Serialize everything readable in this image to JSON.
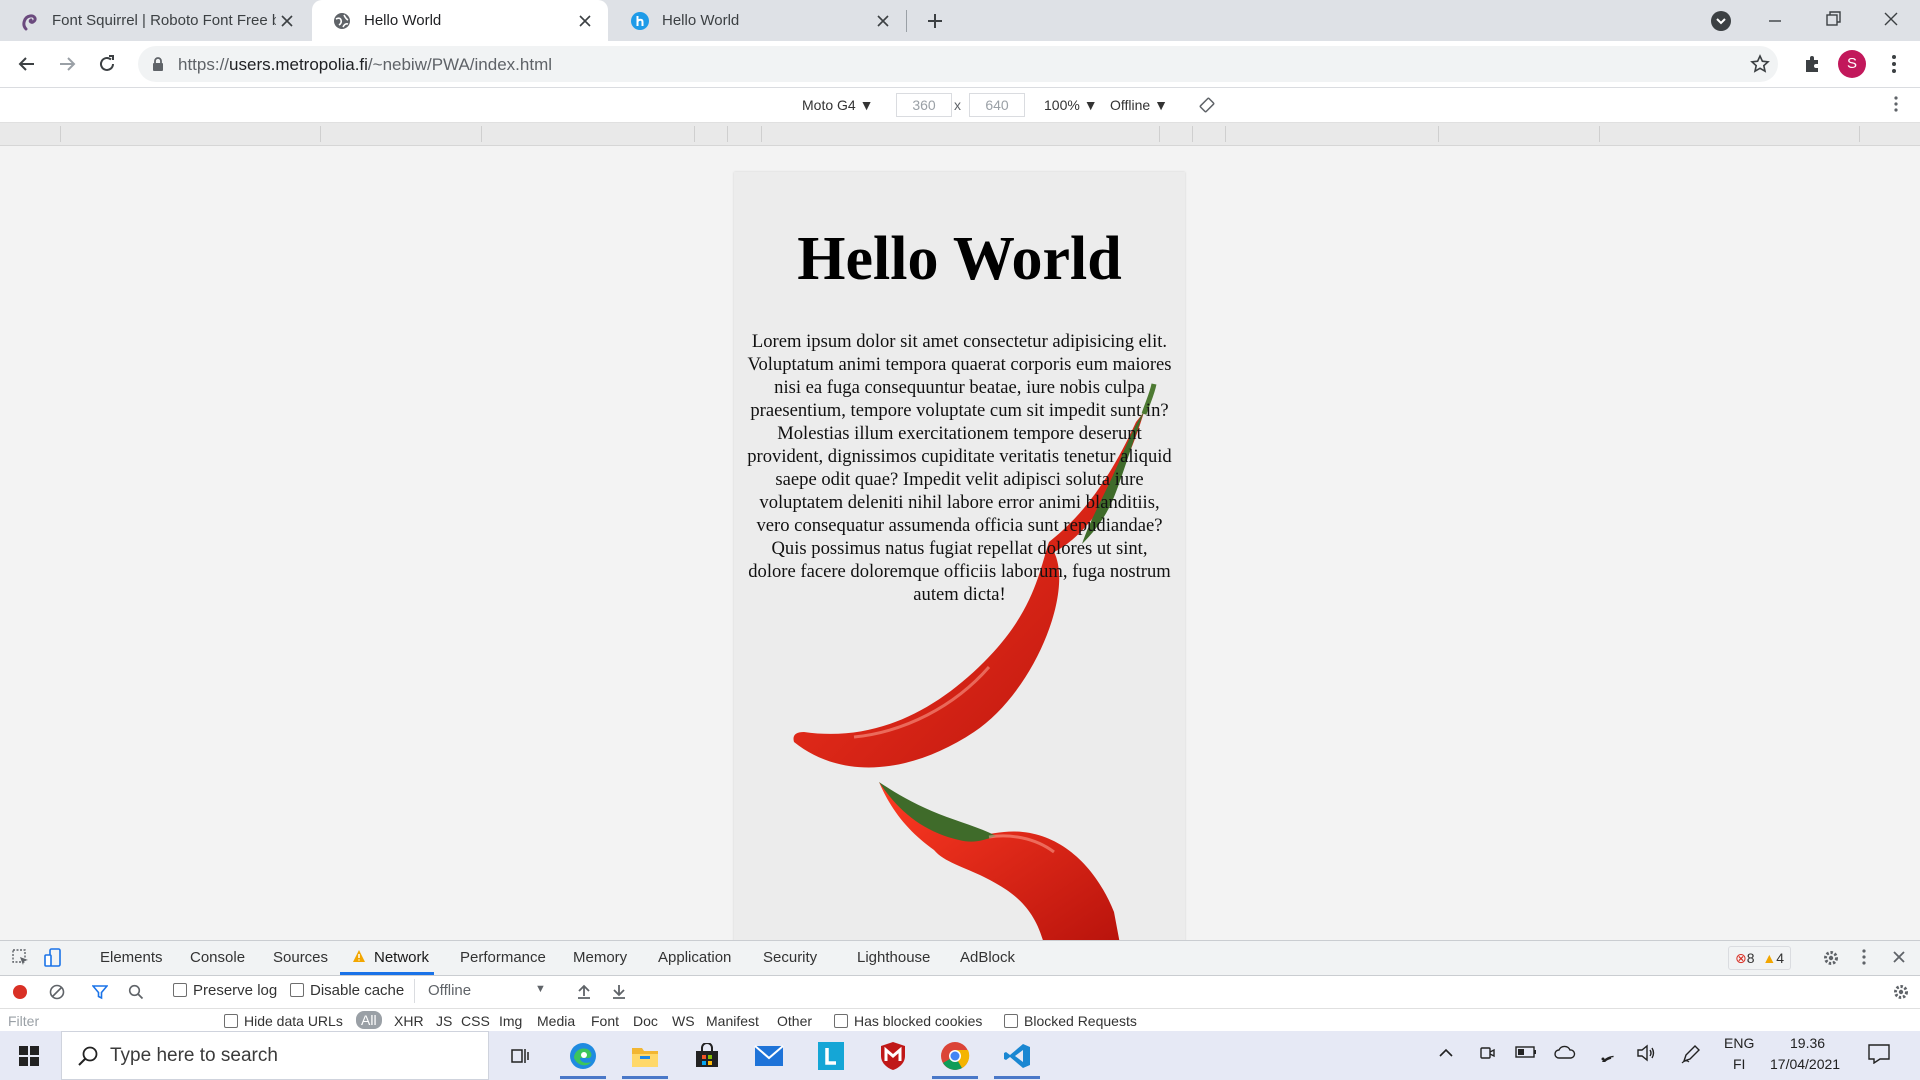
{
  "tabs": [
    {
      "title": "Font Squirrel | Roboto Font Free b",
      "icon": "squirrel-icon"
    },
    {
      "title": "Hello World",
      "icon": "globe-icon",
      "active": true
    },
    {
      "title": "Hello World",
      "icon": "h-app-icon"
    }
  ],
  "address": {
    "host": "users.metropolia.fi",
    "path": "/~nebiw/PWA/index.html"
  },
  "profile_initial": "S",
  "device_toolbar": {
    "device": "Moto G4 ▼",
    "width": "360",
    "times": "x",
    "height": "640",
    "zoom": "100% ▼",
    "throttle": "Offline ▼"
  },
  "page": {
    "heading": "Hello World",
    "body": "Lorem ipsum dolor sit amet consectetur adipisicing elit. Voluptatum animi tempora quaerat corporis eum maiores nisi ea fuga consequuntur beatae, iure nobis culpa praesentium, tempore voluptate cum sit impedit sunt in? Molestias illum exercitationem tempore deserunt provident, dignissimos cupiditate veritatis tenetur aliquid saepe odit quae? Impedit velit adipisci soluta iure voluptatem deleniti nihil labore error animi blanditiis, vero consequatur assumenda officia sunt repudiandae? Quis possimus natus fugiat repellat dolores ut sint, dolore facere doloremque officiis laborum, fuga nostrum autem dicta!"
  },
  "devtools": {
    "tabs": [
      "Elements",
      "Console",
      "Sources",
      "Network",
      "Performance",
      "Memory",
      "Application",
      "Security",
      "Lighthouse",
      "AdBlock"
    ],
    "errors": "8",
    "warnings": "4",
    "preserve_log": "Preserve log",
    "disable_cache": "Disable cache",
    "throttling": "Offline",
    "filter_placeholder": "Filter",
    "hide_data_urls": "Hide data URLs",
    "types": [
      "All",
      "XHR",
      "JS",
      "CSS",
      "Img",
      "Media",
      "Font",
      "Doc",
      "WS",
      "Manifest",
      "Other"
    ],
    "has_blocked_cookies": "Has blocked cookies",
    "blocked_requests": "Blocked Requests"
  },
  "taskbar": {
    "search_placeholder": "Type here to search",
    "lang": "ENG",
    "region": "FI",
    "time": "19.36",
    "date": "17/04/2021"
  },
  "colors": {
    "tab_strip": "#dee1e6",
    "accent": "#1a73e8",
    "record": "#d93025",
    "profile": "#c2185b"
  }
}
